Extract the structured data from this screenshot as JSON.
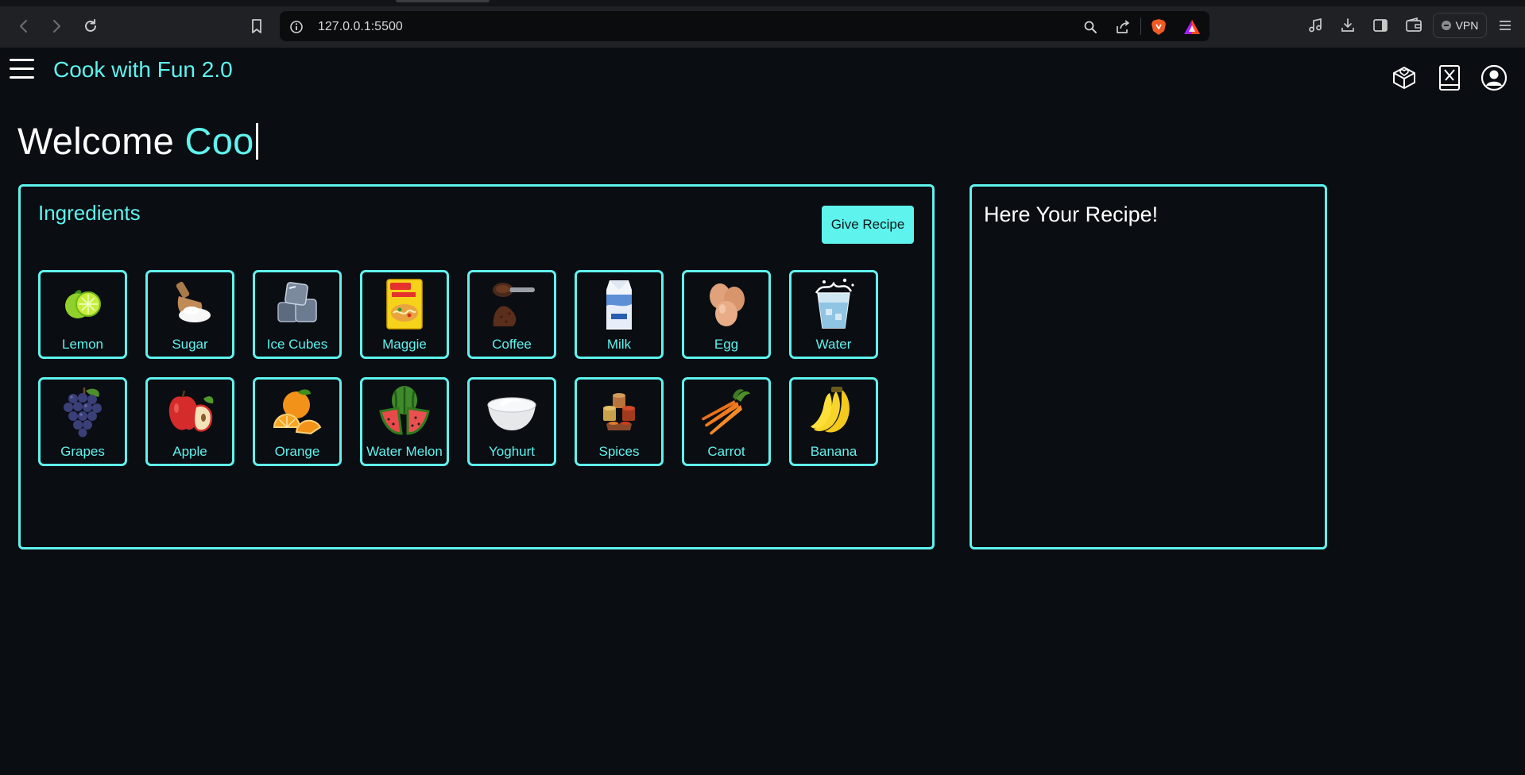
{
  "browser": {
    "url": "127.0.0.1:5500",
    "vpn_label": "VPN"
  },
  "app": {
    "brand": "Cook with Fun 2.0",
    "welcome_prefix": "Welcome",
    "welcome_typed": "Coo",
    "header_icons": [
      "recipe-box-icon",
      "cookbook-icon",
      "user-profile-icon"
    ]
  },
  "ingredients": {
    "title": "Ingredients",
    "give_recipe_label": "Give Recipe",
    "items": [
      {
        "label": "Lemon",
        "icon": "lemon-icon"
      },
      {
        "label": "Sugar",
        "icon": "sugar-icon"
      },
      {
        "label": "Ice Cubes",
        "icon": "ice-cubes-icon"
      },
      {
        "label": "Maggie",
        "icon": "maggie-icon"
      },
      {
        "label": "Coffee",
        "icon": "coffee-icon"
      },
      {
        "label": "Milk",
        "icon": "milk-icon"
      },
      {
        "label": "Egg",
        "icon": "egg-icon"
      },
      {
        "label": "Water",
        "icon": "water-icon"
      },
      {
        "label": "Grapes",
        "icon": "grapes-icon"
      },
      {
        "label": "Apple",
        "icon": "apple-icon"
      },
      {
        "label": "Orange",
        "icon": "orange-icon"
      },
      {
        "label": "Water Melon",
        "icon": "watermelon-icon"
      },
      {
        "label": "Yoghurt",
        "icon": "yoghurt-icon"
      },
      {
        "label": "Spices",
        "icon": "spices-icon"
      },
      {
        "label": "Carrot",
        "icon": "carrot-icon"
      },
      {
        "label": "Banana",
        "icon": "banana-icon"
      }
    ]
  },
  "recipe": {
    "title": "Here Your Recipe!"
  },
  "colors": {
    "accent": "#5ff3ee",
    "background": "#0a0d12"
  }
}
